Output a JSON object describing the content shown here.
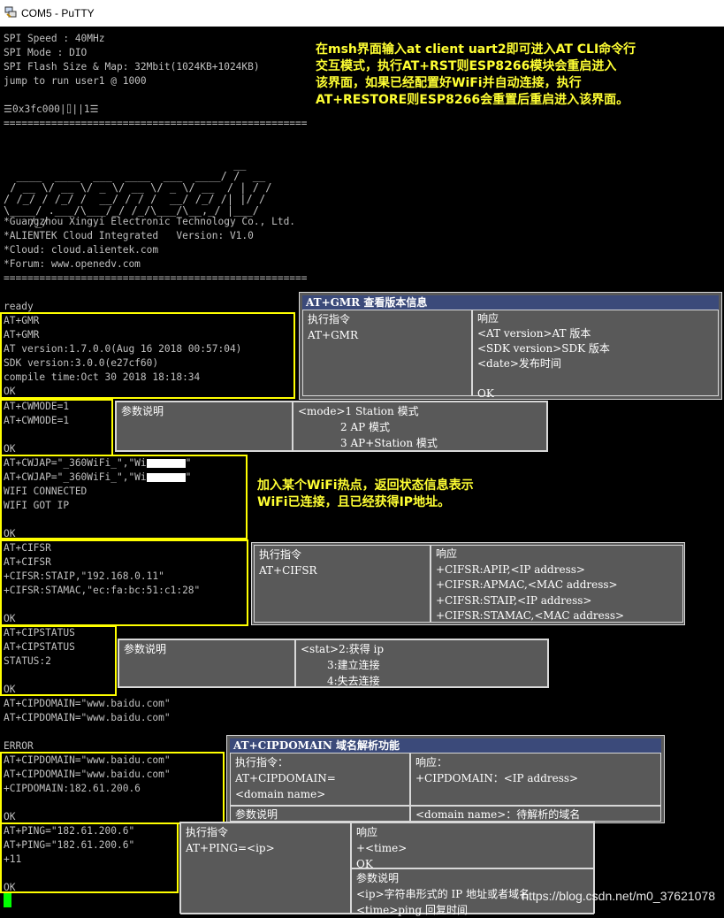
{
  "window": {
    "title": "COM5 - PuTTY",
    "icon": "putty-app-icon"
  },
  "terminal": {
    "boot_lines": [
      "SPI Speed : 40MHz",
      "SPI Mode : DIO",
      "SPI Flash Size & Map: 32Mbit(1024KB+1024KB)",
      "jump to run user1 @ 1000"
    ],
    "garbage_line": "☰0x3fc000|⌷||1☰",
    "separator1": "===================================================",
    "ascii_art": "                                    __\n  ____  ____  ___  ____  ___  ____/ /  __\n / __ \\/ __ \\/ _ \\/ __ \\/ _ \\/ __  / | / /\n/ /_/ / /_/ /  __/ / / /  __/ /_/ /| |/ /\n\\____/ .___/\\___/_/ /_/\\___/\\__,_/ |___/\n    /_/",
    "info_lines": [
      "*Guangzhou Xingyi Electronic Technology Co., Ltd.",
      "*ALIENTEK Cloud Integrated   Version: V1.0",
      "*Cloud: cloud.alientek.com",
      "*Forum: www.openedv.com"
    ],
    "separator2": "===================================================",
    "ready": "ready",
    "gmr_block": [
      "AT+GMR",
      "AT+GMR",
      "AT version:1.7.0.0(Aug 16 2018 00:57:04)",
      "SDK version:3.0.0(e27cf60)",
      "compile time:Oct 30 2018 18:18:34",
      "OK"
    ],
    "cwmode_block": [
      "AT+CWMODE=1",
      "AT+CWMODE=1",
      "",
      "OK"
    ],
    "cwjap_block": [
      "AT+CWJAP=\"_360WiFi_\",\"Wi",
      "AT+CWJAP=\"_360WiFi_\",\"Wi",
      "WIFI CONNECTED",
      "WIFI GOT IP",
      "",
      "OK"
    ],
    "cwjap_tail": "\"",
    "cifsr_block": [
      "AT+CIFSR",
      "AT+CIFSR",
      "+CIFSR:STAIP,\"192.168.0.11\"",
      "+CIFSR:STAMAC,\"ec:fa:bc:51:c1:28\"",
      "",
      "OK"
    ],
    "cipstatus_block": [
      "AT+CIPSTATUS",
      "AT+CIPSTATUS",
      "STATUS:2",
      "",
      "OK"
    ],
    "cipdomain_err_block": [
      "AT+CIPDOMAIN=\"www.baidu.com\"",
      "AT+CIPDOMAIN=\"www.baidu.com\"",
      "",
      "ERROR"
    ],
    "cipdomain_ok_block": [
      "AT+CIPDOMAIN=\"www.baidu.com\"",
      "AT+CIPDOMAIN=\"www.baidu.com\"",
      "+CIPDOMAIN:182.61.200.6",
      "",
      "OK"
    ],
    "ping_block": [
      "AT+PING=\"182.61.200.6\"",
      "AT+PING=\"182.61.200.6\"",
      "+11",
      "",
      "OK"
    ]
  },
  "annotations": {
    "cli_note": [
      "在msh界面输入at client uart2即可进入AT CLI命令行",
      "交互模式，执行AT+RST则ESP8266模块会重启进入",
      "该界面，如果已经配置好WiFi并自动连接，执行",
      "AT+RESTORE则ESP8266会重置后重启进入该界面。"
    ],
    "wifi_note": [
      "加入某个WiFi热点，返回状态信息表示",
      "WiFi已连接，且已经获得IP地址。"
    ]
  },
  "tables": {
    "gmr": {
      "header": "AT+GMR 查看版本信息",
      "col1_title": "执行指令",
      "col1_value": "AT+GMR",
      "col2_title": "响应",
      "col2_lines": [
        "<AT version>AT 版本",
        "<SDK version>SDK 版本",
        "<date>发布时间",
        "",
        "OK"
      ]
    },
    "cwmode": {
      "col1_title": "参数说明",
      "line1": "<mode>1 Station 模式",
      "line2": "2   AP 模式",
      "line3": "3   AP+Station 模式"
    },
    "cifsr": {
      "col1_title": "执行指令",
      "col1_value": "AT+CIFSR",
      "col2_title": "响应",
      "col2_lines": [
        "+CIFSR:APIP,<IP address>",
        "+CIFSR:APMAC,<MAC address>",
        "+CIFSR:STAIP,<IP address>",
        "+CIFSR:STAMAC,<MAC address>"
      ]
    },
    "cipstatus": {
      "col1_title": "参数说明",
      "line1": "<stat>2:获得 ip",
      "line2": "3:建立连接",
      "line3": "4:失去连接"
    },
    "cipdomain": {
      "header": "AT+CIPDOMAIN  域名解析功能",
      "col1_title": "执行指令：",
      "col1_line1": "AT+CIPDOMAIN=",
      "col1_line2": "<domain name>",
      "col2_title": "响应：",
      "col2_value": "+CIPDOMAIN：<IP address>",
      "param_title": "参数说明",
      "param_value": "<domain name>：待解析的域名"
    },
    "ping": {
      "col1_title": "执行指令",
      "col1_value": "AT+PING=<ip>",
      "col2_title": "响应",
      "col2_line1": "+<time>",
      "col2_line2": "OK",
      "param_title": "参数说明",
      "param_line1": "<ip>字符串形式的 IP 地址或者域名",
      "param_line2": "<time>ping 回复时间"
    }
  },
  "watermark": "https://blog.csdn.net/m0_37621078",
  "colors": {
    "terminal_bg": "#000000",
    "terminal_fg": "#c0c0c0",
    "highlight": "#ffff00",
    "note_text": "#ffff33",
    "table_bg": "#595959",
    "table_header": "#3b4a7a",
    "cursor": "#00ff00"
  }
}
